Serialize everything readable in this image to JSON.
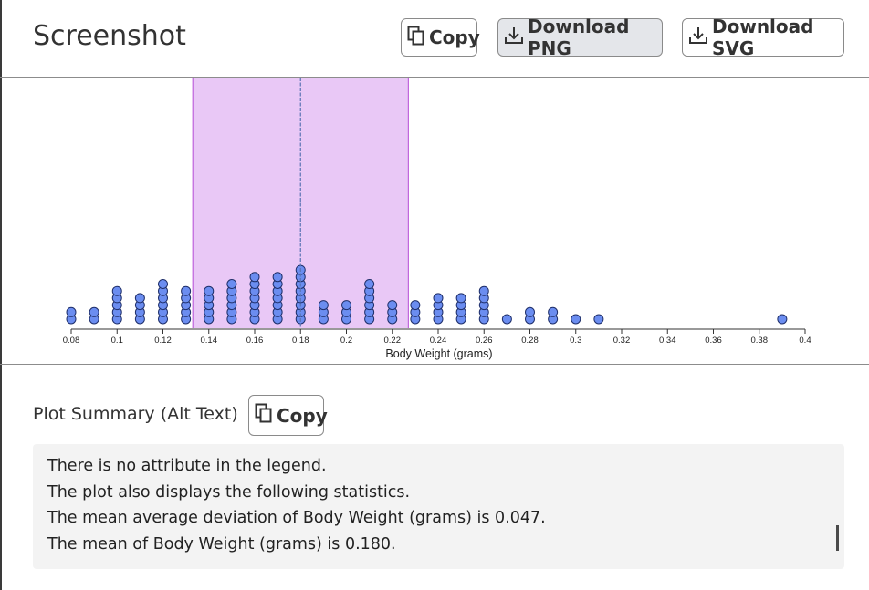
{
  "header": {
    "title": "Screenshot",
    "copy_label": "Copy",
    "download_png_label": "Download PNG",
    "download_svg_label": "Download SVG"
  },
  "chart_data": {
    "type": "scatter",
    "subtype": "dot plot",
    "xlabel": "Body Weight (grams)",
    "xlim": [
      0.08,
      0.4
    ],
    "xticks": [
      "0.08",
      "0.1",
      "0.12",
      "0.14",
      "0.16",
      "0.18",
      "0.2",
      "0.22",
      "0.24",
      "0.26",
      "0.28",
      "0.3",
      "0.32",
      "0.34",
      "0.36",
      "0.38",
      "0.4"
    ],
    "dot_color": "#6b8df0",
    "points": [
      {
        "x": 0.08,
        "count": 2
      },
      {
        "x": 0.09,
        "count": 2
      },
      {
        "x": 0.1,
        "count": 5
      },
      {
        "x": 0.11,
        "count": 4
      },
      {
        "x": 0.12,
        "count": 6
      },
      {
        "x": 0.13,
        "count": 5
      },
      {
        "x": 0.14,
        "count": 5
      },
      {
        "x": 0.15,
        "count": 6
      },
      {
        "x": 0.16,
        "count": 7
      },
      {
        "x": 0.17,
        "count": 7
      },
      {
        "x": 0.18,
        "count": 8
      },
      {
        "x": 0.19,
        "count": 3
      },
      {
        "x": 0.2,
        "count": 3
      },
      {
        "x": 0.21,
        "count": 6
      },
      {
        "x": 0.22,
        "count": 3
      },
      {
        "x": 0.23,
        "count": 3
      },
      {
        "x": 0.24,
        "count": 4
      },
      {
        "x": 0.25,
        "count": 4
      },
      {
        "x": 0.26,
        "count": 5
      },
      {
        "x": 0.27,
        "count": 1
      },
      {
        "x": 0.28,
        "count": 2
      },
      {
        "x": 0.29,
        "count": 2
      },
      {
        "x": 0.3,
        "count": 1
      },
      {
        "x": 0.31,
        "count": 1
      },
      {
        "x": 0.39,
        "count": 1
      }
    ],
    "mean": 0.18,
    "mean_average_deviation": 0.047,
    "band": [
      0.133,
      0.227
    ],
    "band_color": "#e9c8f6",
    "band_edge_color": "#b54bd6",
    "mean_line_color": "#5a74b5"
  },
  "summary": {
    "label": "Plot Summary (Alt Text)",
    "copy_label": "Copy",
    "lines": [
      "There is no attribute in the legend.",
      "The plot also displays the following statistics.",
      "The mean average deviation of Body Weight (grams) is 0.047.",
      "The mean of Body Weight (grams) is 0.180."
    ]
  }
}
